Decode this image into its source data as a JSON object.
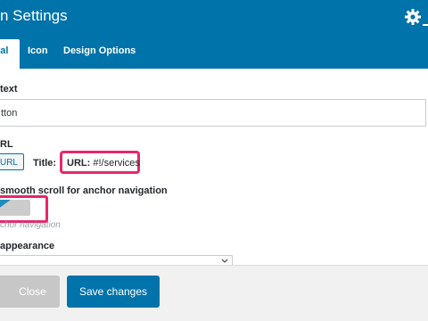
{
  "header": {
    "title": "n Settings",
    "settings_icon": "gear-icon",
    "minimize_icon": "minimize-icon"
  },
  "tabs": [
    {
      "label": "ral",
      "active": true
    },
    {
      "label": "Icon",
      "active": false
    },
    {
      "label": "Design Options",
      "active": false
    }
  ],
  "fields": {
    "text_label": "text",
    "text_value": "tton",
    "url_label": "RL",
    "url_button": "URL",
    "title_label": "Title:",
    "url_info_label": "URL:",
    "url_info_value": "#!/services",
    "smooth_scroll_label": "smooth scroll for anchor navigation",
    "smooth_scroll_helper": "chor navigation",
    "smooth_scroll_state": "on",
    "appearance_label": "appearance",
    "appearance_value": ""
  },
  "footer": {
    "close_label": "Close",
    "save_label": "Save changes"
  },
  "colors": {
    "primary": "#0073aa",
    "highlight": "#e8266b",
    "disabled": "#c7c7c7"
  }
}
